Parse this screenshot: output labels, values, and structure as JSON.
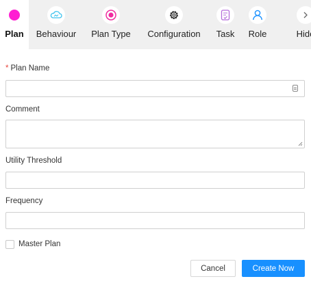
{
  "tabs": [
    {
      "label": "Plan",
      "icon": "plan-dot-icon",
      "active": true
    },
    {
      "label": "Behaviour",
      "icon": "cloud-icon",
      "active": false
    },
    {
      "label": "Plan Type",
      "icon": "target-circle-icon",
      "active": false
    },
    {
      "label": "Configuration",
      "icon": "gear-icon",
      "active": false
    },
    {
      "label": "Task",
      "icon": "task-checklist-icon",
      "active": false
    },
    {
      "label": "Role",
      "icon": "user-icon",
      "active": false
    },
    {
      "label": "Hide",
      "icon": "chevron-right-icon",
      "active": false
    }
  ],
  "form": {
    "required_mark": "*",
    "plan_name_label": "Plan Name",
    "plan_name_value": "",
    "comment_label": "Comment",
    "comment_value": "",
    "utility_threshold_label": "Utility Threshold",
    "utility_threshold_value": "",
    "frequency_label": "Frequency",
    "frequency_value": "",
    "master_plan_label": "Master Plan",
    "master_plan_checked": false,
    "cancel_label": "Cancel",
    "create_label": "Create Now"
  },
  "colors": {
    "accent": "#1890ff",
    "plan_dot": "#ff1fd2",
    "behaviour": "#3fc3ee",
    "plan_type": "#f02ca0",
    "task": "#b36bd9",
    "role": "#1890ff",
    "required": "#e8453c"
  }
}
